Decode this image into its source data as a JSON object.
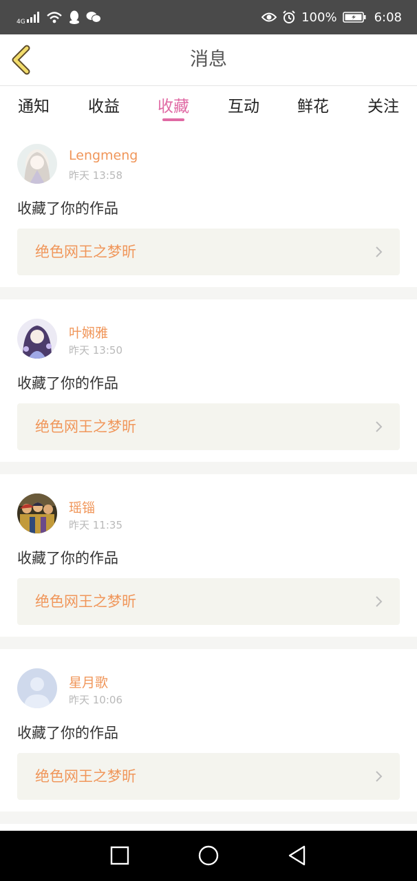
{
  "status_bar": {
    "network": "4G",
    "battery": "100%",
    "time": "6:08",
    "icons": [
      "signal-icon",
      "wifi-icon",
      "qq-icon",
      "wechat-icon",
      "eye-icon",
      "alarm-icon",
      "battery-icon"
    ]
  },
  "header": {
    "title": "消息",
    "back_icon": "chevron-left-icon"
  },
  "tabs": [
    {
      "label": "通知",
      "active": false
    },
    {
      "label": "收益",
      "active": false
    },
    {
      "label": "收藏",
      "active": true
    },
    {
      "label": "互动",
      "active": false
    },
    {
      "label": "鲜花",
      "active": false
    },
    {
      "label": "关注",
      "active": false
    }
  ],
  "notifications": [
    {
      "username": "Lengmeng",
      "time": "昨天 13:58",
      "action": "收藏了你的作品",
      "work_title": "绝色网王之梦昕"
    },
    {
      "username": "叶娴雅",
      "time": "昨天 13:50",
      "action": "收藏了你的作品",
      "work_title": "绝色网王之梦昕"
    },
    {
      "username": "瑶锱",
      "time": "昨天 11:35",
      "action": "收藏了你的作品",
      "work_title": "绝色网王之梦昕"
    },
    {
      "username": "星月歌",
      "time": "昨天 10:06",
      "action": "收藏了你的作品",
      "work_title": "绝色网王之梦昕"
    }
  ],
  "colors": {
    "accent": "#e06aa4",
    "username": "#f0965a",
    "status_bar": "#4a4a4a",
    "card_link_bg": "#f4f4ee"
  },
  "system_nav": [
    "square-icon",
    "circle-icon",
    "triangle-back-icon"
  ]
}
